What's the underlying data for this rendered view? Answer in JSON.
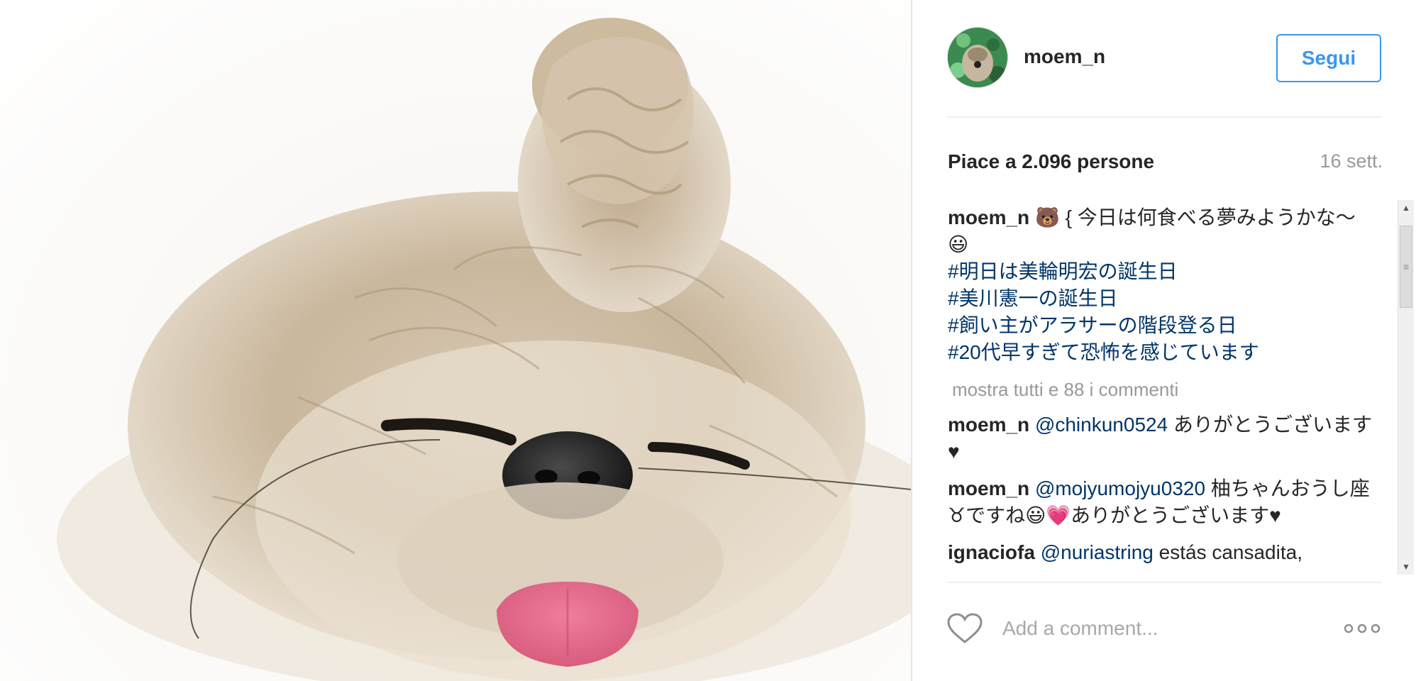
{
  "post": {
    "username": "moem_n",
    "follow_label": "Segui",
    "likes_text": "Piace a 2.096 persone",
    "time_text": "16 sett."
  },
  "caption": {
    "user": "moem_n",
    "text": "{ 今日は何食べる夢みようかな〜😃",
    "hashtags": [
      "#明日は美輪明宏の誕生日",
      "#美川憲一の誕生日",
      "#飼い主がアラサーの階段登る日",
      "#20代早すぎて恐怖を感じています"
    ]
  },
  "show_all_comments": "mostra tutti e 88 i commenti",
  "comments": [
    {
      "user": "moem_n",
      "mention": "@chinkun0524",
      "text": " ありがとうございます♥"
    },
    {
      "user": "moem_n",
      "mention": "@mojyumojyu0320",
      "text": " 柚ちゃんおうし座♉ですね😃💗ありがとうございます♥"
    },
    {
      "user": "ignaciofa",
      "mention": "@nuriastring",
      "text": " estás cansadita,"
    }
  ],
  "comment_box": {
    "placeholder": "Add a comment..."
  },
  "icons": {
    "heart": "heart-icon",
    "more": "more-options-icon",
    "avatar": "avatar"
  },
  "colors": {
    "accent": "#3897f0",
    "hashtag": "#003569",
    "muted": "#999999"
  }
}
